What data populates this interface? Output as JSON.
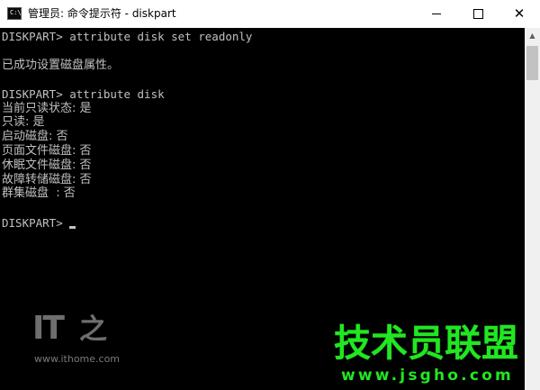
{
  "window": {
    "title": "管理员: 命令提示符 - diskpart",
    "icon": "cmd-console-icon",
    "icon_glyph": "C:\\",
    "controls": {
      "minimize": "minimize-icon",
      "maximize": "maximize-icon",
      "close": "close-icon",
      "close_glyph": "✕"
    }
  },
  "console": {
    "lines": [
      "DISKPART> attribute disk set readonly",
      "",
      "已成功设置磁盘属性。",
      "",
      "DISKPART> attribute disk",
      "当前只读状态: 是",
      "只读: 是",
      "启动磁盘: 否",
      "页面文件磁盘: 否",
      "休眠文件磁盘: 否",
      "故障转储磁盘: 否",
      "群集磁盘  : 否",
      "",
      "DISKPART> "
    ],
    "text_color": "#c0c0c0",
    "background": "#000000"
  },
  "scrollbar": {
    "up_glyph": "▲"
  },
  "watermarks": {
    "ithome_logo_it": "IT",
    "ithome_logo_char": "之",
    "ithome_url": "www.ithome.com",
    "brand": "技术员联盟",
    "brand_url": "www.jsgho.com",
    "brand_color": "#22e622"
  }
}
